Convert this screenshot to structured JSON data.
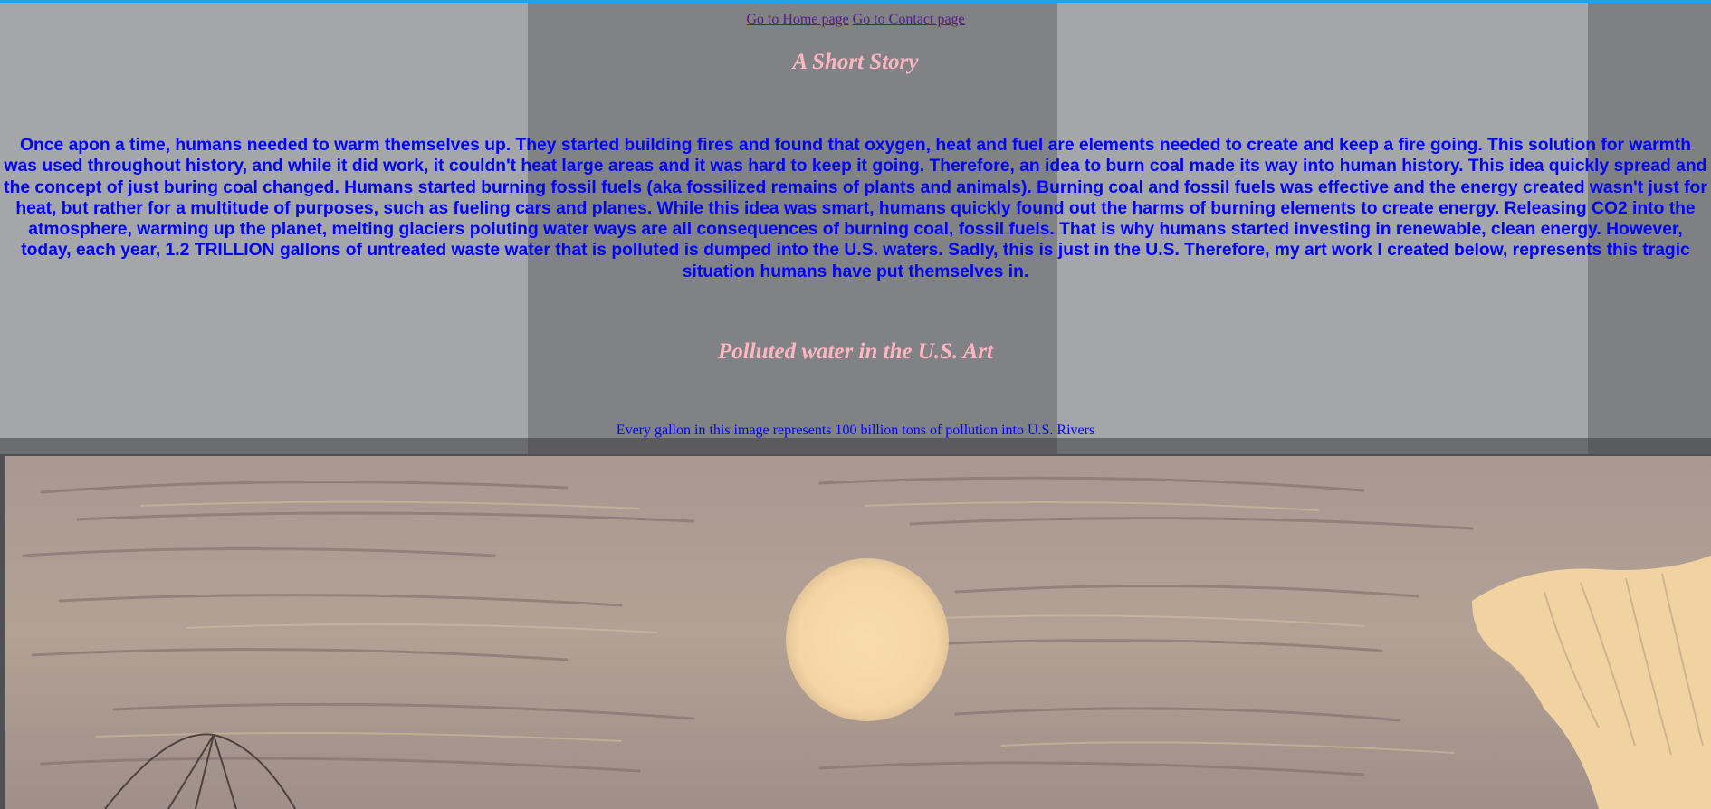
{
  "nav": {
    "home_link": "Go to Home page",
    "contact_link": "Go to Contact page"
  },
  "story": {
    "title": "A Short Story",
    "body": "Once apon a time, humans needed to warm themselves up. They started building fires and found that oxygen, heat and fuel are elements needed to create and keep a fire going. This solution for warmth was used throughout history, and while it did work, it couldn't heat large areas and it was hard to keep it going. Therefore, an idea to burn coal made its way into human history. This idea quickly spread and the concept of just buring coal changed. Humans started burning fossil fuels (aka fossilized remains of plants and animals). Burning coal and fossil fuels was effective and the energy created wasn't just for heat, but rather for a multitude of purposes, such as fueling cars and planes. While this idea was smart, humans quickly found out the harms of burning elements to create energy. Releasing CO2 into the atmosphere, warming up the planet, melting glaciers poluting water ways are all consequences of burning coal, fossil fuels. That is why humans started investing in renewable, clean energy. However, today, each year, 1.2 TRILLION gallons of untreated waste water that is polluted is dumped into the U.S. waters. Sadly, this is just in the U.S. Therefore, my art work I created below, represents this tragic situation humans have put themselves in."
  },
  "art": {
    "title": "Polluted water in the U.S. Art",
    "caption": "Every gallon in this image represents 100 billion tons of pollution into U.S. Rivers"
  },
  "colors": {
    "accent_line": "#2d9fd9",
    "heading": "#ffb6c1",
    "body_text": "#0000ff",
    "link": "#551a8b",
    "art_paper": "#f5d9a8",
    "art_shading": "#8a7a76"
  }
}
